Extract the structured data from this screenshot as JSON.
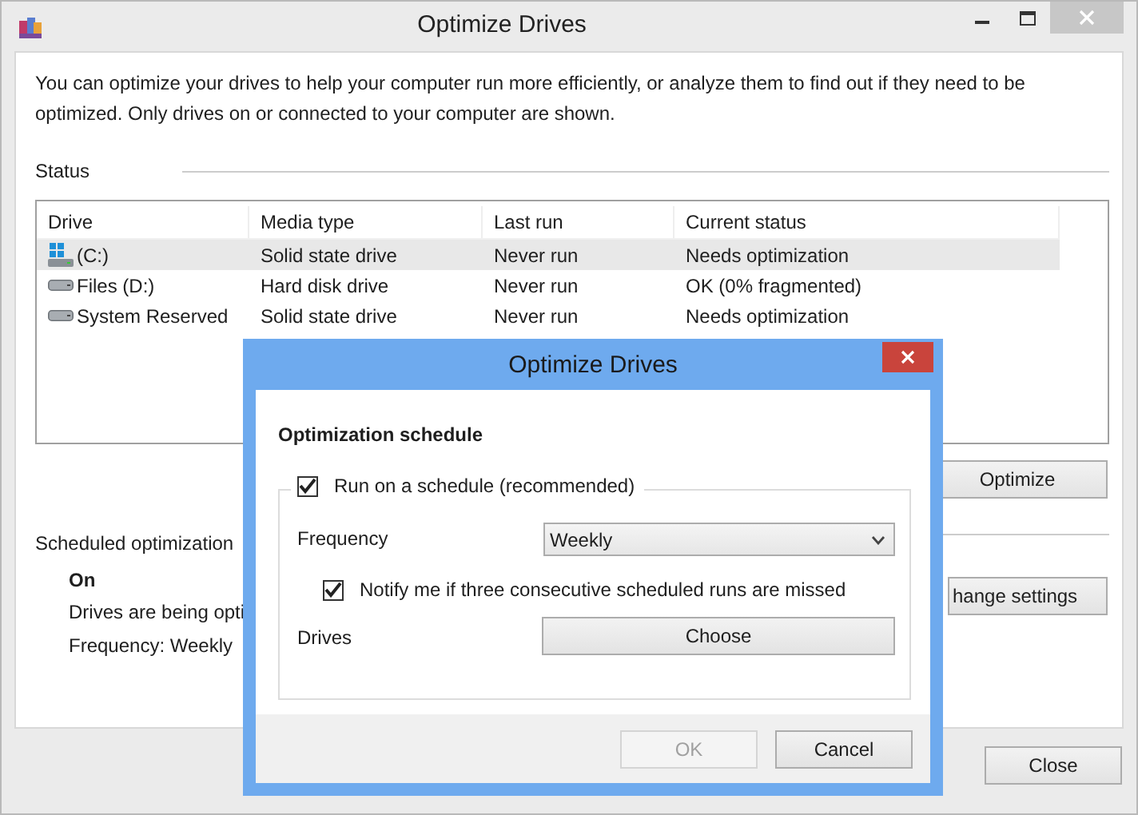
{
  "window": {
    "title": "Optimize Drives"
  },
  "description": "You can optimize your drives to help your computer run more efficiently, or analyze them to find out if they need to be optimized. Only drives on or connected to your computer are shown.",
  "status_label": "Status",
  "drives_table": {
    "columns": [
      "Drive",
      "Media type",
      "Last run",
      "Current status"
    ],
    "rows": [
      {
        "kind": "system",
        "drive": "(C:)",
        "media_type": "Solid state drive",
        "last_run": "Never run",
        "current_status": "Needs optimization",
        "selected": true
      },
      {
        "kind": "disk",
        "drive": "Files (D:)",
        "media_type": "Hard disk drive",
        "last_run": "Never run",
        "current_status": "OK (0% fragmented)",
        "selected": false
      },
      {
        "kind": "disk",
        "drive": "System Reserved",
        "media_type": "Solid state drive",
        "last_run": "Never run",
        "current_status": "Needs optimization",
        "selected": false
      }
    ]
  },
  "optimize_button": "Optimize",
  "scheduled": {
    "label": "Scheduled optimization",
    "state": "On",
    "lines": [
      "Drives are being opti",
      "Frequency: Weekly"
    ],
    "button": "hange settings"
  },
  "close_button": "Close",
  "dialog": {
    "title": "Optimize Drives",
    "heading": "Optimization schedule",
    "run_on_schedule": {
      "label": "Run on a schedule (recommended)",
      "checked": true
    },
    "frequency": {
      "label": "Frequency",
      "value": "Weekly"
    },
    "notify": {
      "label": "Notify me if three consecutive scheduled runs are missed",
      "checked": true
    },
    "drives": {
      "label": "Drives",
      "button": "Choose"
    },
    "buttons": [
      {
        "label": "OK",
        "disabled": true
      },
      {
        "label": "Cancel",
        "disabled": false
      }
    ]
  }
}
